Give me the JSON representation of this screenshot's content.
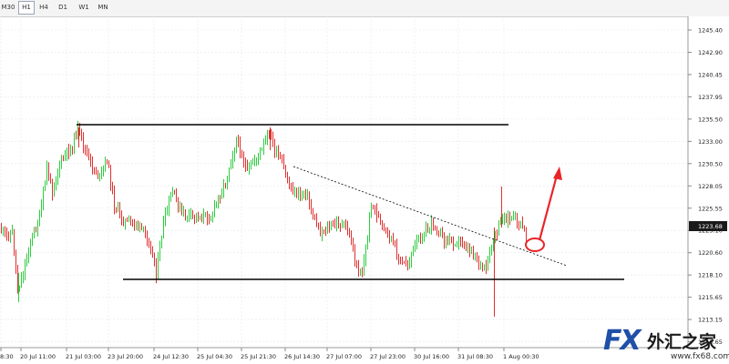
{
  "timeframes": [
    {
      "label": "M30",
      "active": false
    },
    {
      "label": "H1",
      "active": true
    },
    {
      "label": "H4",
      "active": false
    },
    {
      "label": "D1",
      "active": false
    },
    {
      "label": "W1",
      "active": false
    },
    {
      "label": "MN",
      "active": false
    }
  ],
  "price_axis": {
    "labels": [
      "1245.40",
      "1242.90",
      "1240.45",
      "1237.95",
      "1235.50",
      "1233.00",
      "1230.50",
      "1228.05",
      "1225.55",
      "1223.10",
      "1220.60",
      "1218.10",
      "1215.65",
      "1213.15",
      "1210.65"
    ],
    "current_price": "1223.68"
  },
  "time_axis": {
    "labels": [
      "8:30",
      "20 Jul 11:00",
      "21 Jul 03:00",
      "23 Jul 20:00",
      "24 Jul 12:30",
      "25 Jul 04:30",
      "25 Jul 21:30",
      "26 Jul 14:30",
      "27 Jul 07:00",
      "27 Jul 23:00",
      "30 Jul 16:00",
      "31 Jul 08:30",
      "1 Aug 00:30"
    ]
  },
  "watermark": {
    "brand": "FX",
    "chinese_name": "外汇之家",
    "url": "www.fx68.com"
  },
  "colors": {
    "up_candle": "#2ecc40",
    "down_candle": "#e03030",
    "annotation": "#e8262a",
    "lines": "#000000",
    "grid": "#e2e8ec"
  }
}
